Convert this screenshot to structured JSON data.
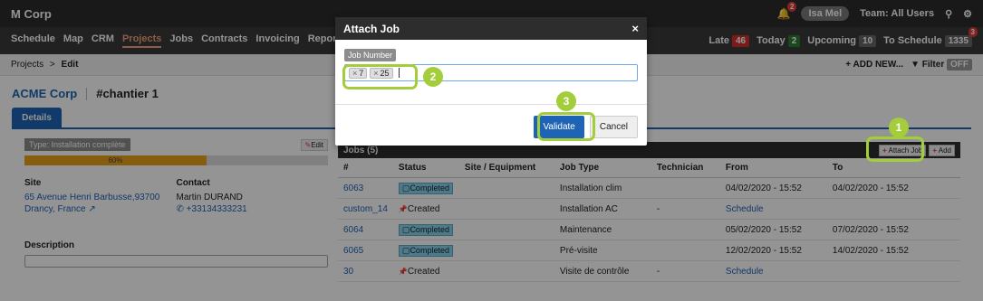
{
  "topbar": {
    "brand": "M Corp",
    "notif_count": "2",
    "user": "Isa Mel",
    "team": "Team: All Users"
  },
  "nav": {
    "items": [
      "Schedule",
      "Map",
      "CRM",
      "Projects",
      "Jobs",
      "Contracts",
      "Invoicing",
      "Reporting"
    ],
    "active": "Projects",
    "late_label": "Late",
    "late_count": "46",
    "today_label": "Today",
    "today_count": "2",
    "upcoming_label": "Upcoming",
    "upcoming_count": "10",
    "to_schedule_label": "To Schedule",
    "to_schedule_count": "1335",
    "to_schedule_alert": "3"
  },
  "crumbs": {
    "parent": "Projects",
    "separator": ">",
    "current": "Edit",
    "add_new": "+ ADD NEW...",
    "filter": "Filter",
    "filter_state": "OFF"
  },
  "project": {
    "client": "ACME Corp",
    "name": "#chantier 1",
    "tab": "Details"
  },
  "details": {
    "type_label": "Type: Installation complète",
    "edit_label": "Edit",
    "progress_text": "60%",
    "progress_value": 0.6,
    "site_h": "Site",
    "site_line1": "65 Avenue Henri Barbusse,93700",
    "site_line2": "Drancy, France",
    "contact_h": "Contact",
    "contact_name": "Martin DURAND",
    "contact_phone": "+33134333231",
    "description_h": "Description"
  },
  "jobs": {
    "title": "Jobs (5)",
    "attach_label": "Attach Job",
    "add_label": "Add",
    "columns": [
      "#",
      "Status",
      "Site / Equipment",
      "Job Type",
      "Technician",
      "From",
      "To"
    ],
    "rows": [
      {
        "id": "6063",
        "status": "Completed",
        "status_kind": "done",
        "site": "",
        "type": "Installation clim",
        "tech": "",
        "from": "04/02/2020 - 15:52",
        "to": "04/02/2020 - 15:52"
      },
      {
        "id": "custom_14",
        "status": "Created",
        "status_kind": "created",
        "site": "",
        "type": "Installation AC",
        "tech": "-",
        "from": "Schedule",
        "to": ""
      },
      {
        "id": "6064",
        "status": "Completed",
        "status_kind": "done",
        "site": "",
        "type": "Maintenance",
        "tech": "",
        "from": "05/02/2020 - 15:52",
        "to": "07/02/2020 - 15:52"
      },
      {
        "id": "6065",
        "status": "Completed",
        "status_kind": "done",
        "site": "",
        "type": "Pré-visite",
        "tech": "",
        "from": "12/02/2020 - 15:52",
        "to": "14/02/2020 - 15:52"
      },
      {
        "id": "30",
        "status": "Created",
        "status_kind": "created",
        "site": "",
        "type": "Visite de contrôle",
        "tech": "-",
        "from": "Schedule",
        "to": ""
      }
    ]
  },
  "modal": {
    "title": "Attach Job",
    "close": "×",
    "field_label": "Job Number",
    "tags": [
      "7",
      "25"
    ],
    "validate_label": "Validate",
    "cancel_label": "Cancel"
  },
  "annotations": {
    "step1": "1",
    "step2": "2",
    "step3": "3",
    "color": "#a3cd3a"
  }
}
